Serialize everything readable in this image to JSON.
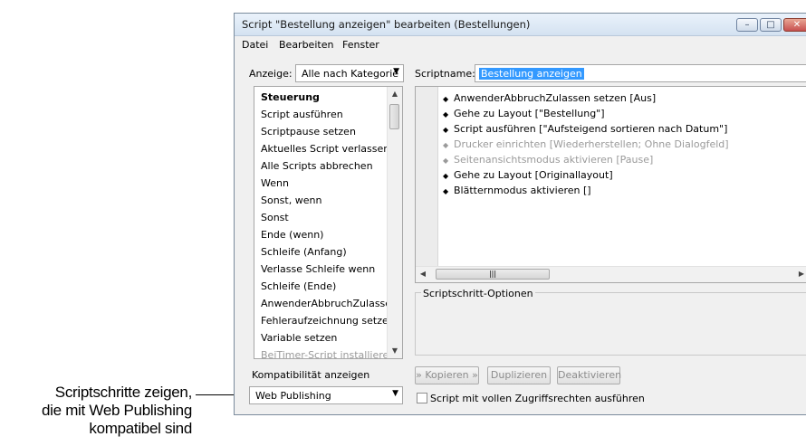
{
  "callout": {
    "lines": [
      "Scriptschritte zeigen,",
      "die mit Web Publishing",
      "kompatibel sind"
    ]
  },
  "window": {
    "title": "Script \"Bestellung anzeigen\" bearbeiten (Bestellungen)",
    "controls": {
      "minimize": "–",
      "maximize": "□",
      "close": "✕"
    }
  },
  "menu": [
    "Datei",
    "Bearbeiten",
    "Fenster"
  ],
  "view": {
    "label": "Anzeige:",
    "value": "Alle nach Kategorie"
  },
  "script_name": {
    "label": "Scriptname:",
    "value": "Bestellung anzeigen"
  },
  "steps": {
    "header": "Steuerung",
    "items": [
      "Script ausführen",
      "Scriptpause setzen",
      "Aktuelles Script verlassen",
      "Alle Scripts abbrechen",
      "Wenn",
      "Sonst, wenn",
      "Sonst",
      "Ende (wenn)",
      "Schleife (Anfang)",
      "Verlasse Schleife wenn",
      "Schleife (Ende)",
      "AnwenderAbbruchZulassen...",
      "Fehleraufzeichnung setzen",
      "Variable setzen",
      "BeiTimer-Script installieren"
    ]
  },
  "script_lines": [
    {
      "text": "AnwenderAbbruchZulassen setzen [Aus]",
      "disabled": false
    },
    {
      "text": "Gehe zu Layout [\"Bestellung\"]",
      "disabled": false
    },
    {
      "text": "Script ausführen [\"Aufsteigend sortieren nach Datum\"]",
      "disabled": false
    },
    {
      "text": "Drucker einrichten [Wiederherstellen; Ohne Dialogfeld]",
      "disabled": true
    },
    {
      "text": "Seitenansichtsmodus aktivieren [Pause]",
      "disabled": true
    },
    {
      "text": "Gehe zu Layout [Originallayout]",
      "disabled": false
    },
    {
      "text": "Blätternmodus aktivieren []",
      "disabled": false
    }
  ],
  "options": {
    "title": "Scriptschritt-Optionen"
  },
  "compatibility": {
    "label": "Kompatibilität anzeigen",
    "value": "Web Publishing"
  },
  "buttons": {
    "copy": "» Kopieren »",
    "duplicate": "Duplizieren",
    "deactivate": "Deaktivieren"
  },
  "full_access": {
    "label": "Script mit vollen Zugriffsrechten ausführen",
    "checked": false
  }
}
